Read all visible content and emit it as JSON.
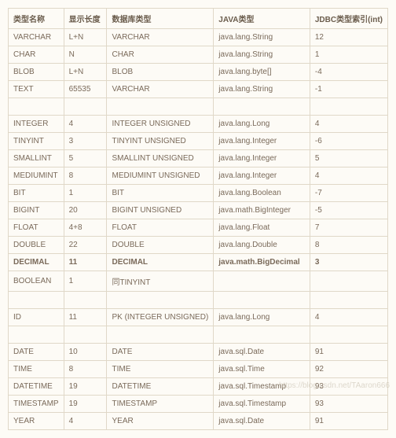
{
  "headers": [
    "类型名称",
    "显示长度",
    "数据库类型",
    "JAVA类型",
    "JDBC类型索引(int)"
  ],
  "rows": [
    {
      "c": [
        "VARCHAR",
        "L+N",
        "VARCHAR",
        "java.lang.String",
        "12"
      ]
    },
    {
      "c": [
        "CHAR",
        "N",
        "CHAR",
        "java.lang.String",
        "1"
      ]
    },
    {
      "c": [
        "BLOB",
        "L+N",
        "BLOB",
        "java.lang.byte[]",
        "-4"
      ]
    },
    {
      "c": [
        "TEXT",
        "65535",
        "VARCHAR",
        "java.lang.String",
        "-1"
      ]
    },
    {
      "c": [
        "",
        "",
        "",
        "",
        ""
      ]
    },
    {
      "c": [
        "INTEGER",
        "4",
        "INTEGER UNSIGNED",
        "java.lang.Long",
        "4"
      ]
    },
    {
      "c": [
        "TINYINT",
        "3",
        "TINYINT UNSIGNED",
        "java.lang.Integer",
        "-6"
      ]
    },
    {
      "c": [
        "SMALLINT",
        "5",
        "SMALLINT UNSIGNED",
        "java.lang.Integer",
        "5"
      ]
    },
    {
      "c": [
        "MEDIUMINT",
        "8",
        "MEDIUMINT UNSIGNED",
        "java.lang.Integer",
        "4"
      ]
    },
    {
      "c": [
        "BIT",
        "1",
        "BIT",
        "java.lang.Boolean",
        "-7"
      ]
    },
    {
      "c": [
        "BIGINT",
        "20",
        "BIGINT UNSIGNED",
        "java.math.BigInteger",
        "-5"
      ]
    },
    {
      "c": [
        "FLOAT",
        "4+8",
        "FLOAT",
        "java.lang.Float",
        "7"
      ]
    },
    {
      "c": [
        "DOUBLE",
        "22",
        "DOUBLE",
        "java.lang.Double",
        "8"
      ]
    },
    {
      "c": [
        "DECIMAL",
        "11",
        "DECIMAL",
        "java.math.BigDecimal",
        "3"
      ],
      "bold": true
    },
    {
      "c": [
        "BOOLEAN",
        "1",
        "同TINYINT",
        "",
        ""
      ]
    },
    {
      "c": [
        "",
        "",
        "",
        "",
        ""
      ]
    },
    {
      "c": [
        "ID",
        "11",
        "PK (INTEGER UNSIGNED)",
        "java.lang.Long",
        "4"
      ]
    },
    {
      "c": [
        "",
        "",
        "",
        "",
        ""
      ]
    },
    {
      "c": [
        "DATE",
        "10",
        "DATE",
        "java.sql.Date",
        "91"
      ]
    },
    {
      "c": [
        "TIME",
        "8",
        "TIME",
        "java.sql.Time",
        "92"
      ]
    },
    {
      "c": [
        "DATETIME",
        "19",
        "DATETIME",
        "java.sql.Timestamp",
        "93"
      ]
    },
    {
      "c": [
        "TIMESTAMP",
        "19",
        "TIMESTAMP",
        "java.sql.Timestamp",
        "93"
      ]
    },
    {
      "c": [
        "YEAR",
        "4",
        "YEAR",
        "java.sql.Date",
        "91"
      ]
    }
  ],
  "watermark": "https://blog.csdn.net/TAaron666"
}
